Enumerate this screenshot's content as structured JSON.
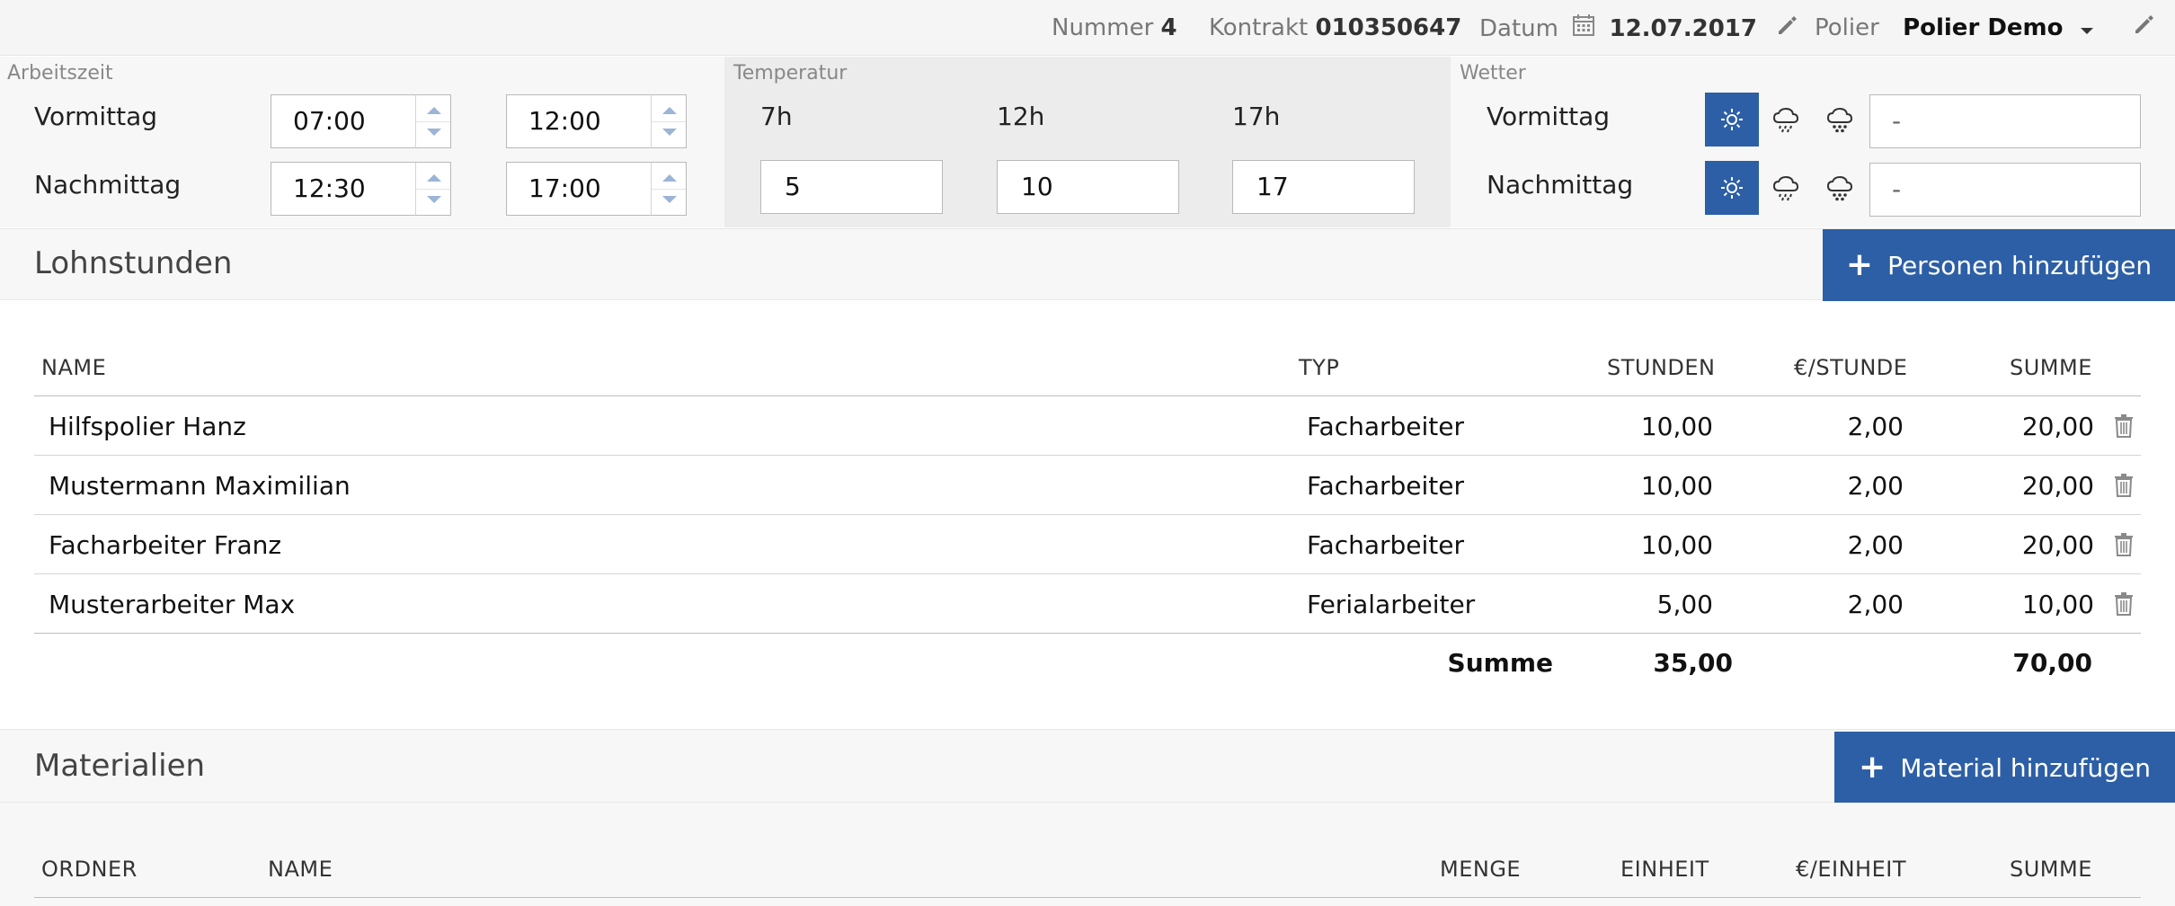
{
  "topbar": {
    "nummer_label": "Nummer",
    "nummer_value": "4",
    "kontrakt_label": "Kontrakt",
    "kontrakt_value": "010350647",
    "datum_label": "Datum",
    "datum_value": "12.07.2017",
    "polier_label": "Polier",
    "polier_value": "Polier Demo"
  },
  "arbeitszeit": {
    "label": "Arbeitszeit",
    "vormittag_label": "Vormittag",
    "nachmittag_label": "Nachmittag",
    "vm_from": "07:00",
    "vm_to": "12:00",
    "nm_from": "12:30",
    "nm_to": "17:00"
  },
  "temperatur": {
    "label": "Temperatur",
    "h7_label": "7h",
    "h12_label": "12h",
    "h17_label": "17h",
    "h7": "5",
    "h12": "10",
    "h17": "17"
  },
  "wetter": {
    "label": "Wetter",
    "vormittag_label": "Vormittag",
    "nachmittag_label": "Nachmittag",
    "vm_text": "-",
    "nm_text": "-",
    "icons": [
      "sun-icon",
      "rain-cloud-icon",
      "snow-cloud-icon"
    ],
    "vm_selected": "sun-icon",
    "nm_selected": "sun-icon"
  },
  "lohnstunden": {
    "title": "Lohnstunden",
    "add_label": "Personen hinzufügen",
    "columns": {
      "name": "NAME",
      "typ": "TYP",
      "stunden": "STUNDEN",
      "preis": "€/STUNDE",
      "summe": "SUMME"
    },
    "rows": [
      {
        "name": "Hilfspolier Hanz",
        "typ": "Facharbeiter",
        "stunden": "10,00",
        "preis": "2,00",
        "summe": "20,00"
      },
      {
        "name": "Mustermann Maximilian",
        "typ": "Facharbeiter",
        "stunden": "10,00",
        "preis": "2,00",
        "summe": "20,00"
      },
      {
        "name": "Facharbeiter Franz",
        "typ": "Facharbeiter",
        "stunden": "10,00",
        "preis": "2,00",
        "summe": "20,00"
      },
      {
        "name": "Musterarbeiter Max",
        "typ": "Ferialarbeiter",
        "stunden": "5,00",
        "preis": "2,00",
        "summe": "10,00"
      }
    ],
    "total_label": "Summe",
    "total_stunden": "35,00",
    "total_summe": "70,00"
  },
  "materialien": {
    "title": "Materialien",
    "add_label": "Material hinzufügen",
    "columns": {
      "ordner": "ORDNER",
      "name": "NAME",
      "menge": "MENGE",
      "einheit": "EINHEIT",
      "preis": "€/EINHEIT",
      "summe": "SUMME"
    }
  },
  "colors": {
    "accent": "#2d5fa6"
  }
}
